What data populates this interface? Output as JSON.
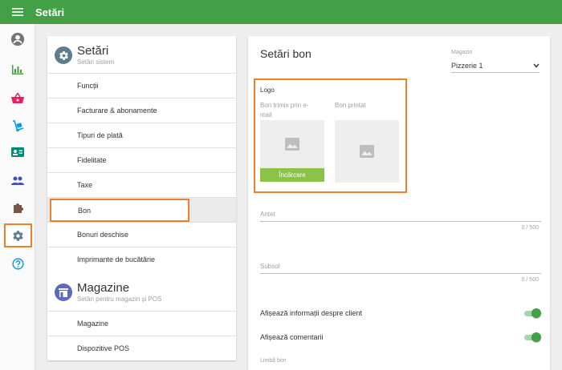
{
  "topbar": {
    "title": "Setări",
    "menu_icon": "hamburger-icon"
  },
  "rail": {
    "items": [
      {
        "icon": "account-circle-icon",
        "color": "#757575"
      },
      {
        "icon": "bar-chart-icon",
        "color": "#43a047"
      },
      {
        "icon": "basket-icon",
        "color": "#e91e63"
      },
      {
        "icon": "hand-truck-icon",
        "color": "#039be5"
      },
      {
        "icon": "id-card-icon",
        "color": "#00897b"
      },
      {
        "icon": "people-icon",
        "color": "#3f51b5"
      },
      {
        "icon": "puzzle-icon",
        "color": "#795548"
      },
      {
        "icon": "gear-icon",
        "color": "#607d8b",
        "active": true
      },
      {
        "icon": "help-circle-icon",
        "color": "#039be5"
      }
    ]
  },
  "settings_section": {
    "title": "Setări",
    "subtitle": "Setări sistem",
    "items": [
      "Funcții",
      "Facturare & abonamente",
      "Tipuri de plată",
      "Fidelitate",
      "Taxe",
      "Bon",
      "Bonuri deschise",
      "Imprimante de bucătărie"
    ],
    "selected": "Bon"
  },
  "stores_section": {
    "title": "Magazine",
    "subtitle": "Setări pentru magazin și POS",
    "items": [
      "Magazine",
      "Dispozitive POS"
    ]
  },
  "receipt": {
    "title": "Setări bon",
    "store_label": "Magazin",
    "store_value": "Pizzerie 1",
    "logo_label": "Logo",
    "email_caption_1": "Bon trimis prin e-",
    "email_caption_2": "mail",
    "printed_caption": "Bon printat",
    "upload_label": "Încărcare",
    "header_label": "Antet",
    "header_counter": "0 / 500",
    "footer_label": "Subsol",
    "footer_counter": "0 / 500",
    "toggle_client": "Afișează informații despre client",
    "toggle_comments": "Afișează comentarii",
    "language_label": "Limbă bon"
  },
  "colors": {
    "primary": "#43a047",
    "highlight": "#f07f2a",
    "upload": "#8bc34a"
  }
}
